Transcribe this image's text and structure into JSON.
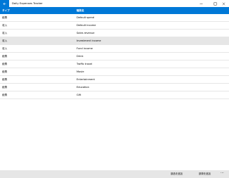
{
  "window": {
    "title": "Daily Expenses Tracker"
  },
  "table": {
    "headers": {
      "type": "タイプ",
      "category": "種別名"
    },
    "rows": [
      {
        "type": "経費",
        "category": "Default spend"
      },
      {
        "type": "収入",
        "category": "Default income"
      },
      {
        "type": "収入",
        "category": "Sales revenue"
      },
      {
        "type": "収入",
        "category": "Investment income"
      },
      {
        "type": "収入",
        "category": "Fund income"
      },
      {
        "type": "経費",
        "category": "Drink"
      },
      {
        "type": "経費",
        "category": "Traffic travel"
      },
      {
        "type": "経費",
        "category": "Movie"
      },
      {
        "type": "経費",
        "category": "Entertainment"
      },
      {
        "type": "経費",
        "category": "Education"
      },
      {
        "type": "経費",
        "category": "Gift"
      }
    ]
  },
  "appbar": {
    "add_category": "部品を追加",
    "add_expense": "部費を追加",
    "more": "···"
  },
  "colors": {
    "accent": "#0078d7",
    "selected_row": "#e6e6e6",
    "appbar": "#e6e6e6"
  },
  "icons": {
    "back": "back-arrow-icon",
    "minimize": "minimize-icon",
    "maximize": "maximize-icon",
    "close": "close-icon"
  }
}
